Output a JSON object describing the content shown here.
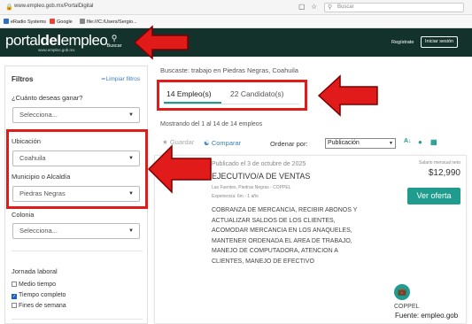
{
  "browser": {
    "url": "www.empleo.gob.mx/PortalDigital",
    "search_placeholder": "Buscar",
    "bookmarks": [
      {
        "label": "eRadio Systems",
        "color": "#2c6fbf"
      },
      {
        "label": "Google",
        "color": "#ea4335"
      },
      {
        "label": "file:///C:/Users/Sergio...",
        "color": "#888888"
      }
    ]
  },
  "header": {
    "logo_light": "portal",
    "logo_bold": "del",
    "logo_end": "empleo",
    "logo_sub": "www.empleo.gob.mx",
    "search_label": "Buscar",
    "register": "Regístrate",
    "login": "Iniciar sesión"
  },
  "sidebar": {
    "title": "Filtros",
    "clear": "Limpiar filtros",
    "salary_label": "¿Cuánto deseas ganar?",
    "salary_value": "Selecciona...",
    "location_label": "Ubicación",
    "location_value": "Coahuila",
    "municipality_label": "Municipio o Alcaldía",
    "municipality_value": "Piedras Negras",
    "colony_label": "Colonia",
    "colony_value": "Selecciona...",
    "schedule_label": "Jornada laboral",
    "schedules": [
      {
        "label": "Medio tiempo",
        "checked": false
      },
      {
        "label": "Tiempo completo",
        "checked": true
      },
      {
        "label": "Fines de semana",
        "checked": false
      }
    ]
  },
  "main": {
    "crumb": "Buscaste: trabajo en Piedras Negras, Coahuila",
    "tab_jobs": "14 Empleo(s)",
    "tab_candidates": "22 Candidato(s)",
    "showing": "Mostrando del 1 al 14 de 14 empleos",
    "save": "Guardar",
    "compare": "Comparar",
    "order_label": "Ordenar por:",
    "order_value": "Publicación"
  },
  "job": {
    "date": "Publicado el 3 de octubre de 2025",
    "title": "EJECUTIVO/A DE VENTAS",
    "company": "Las Fuentes, Piedras Negras - COPPEL",
    "experience": "Experiencia: 6m - 1 año",
    "description": "COBRANZA DE MERCANCIA, RECIBIR ABONOS Y ACTUALIZAR SALDOS DE LOS CLIENTES, ACOMODAR MERCANCIA EN LOS ANAQUELES, MANTENER ORDENADA EL AREA DE TRABAJO, MANEJO DE COMPUTADORA, ATENCION A CLIENTES, MANEJO DE EFECTIVO",
    "salary_label": "Salario mensual neto",
    "salary": "$12,990",
    "button": "Ver oferta",
    "company_name": "COPPEL"
  },
  "source": "Fuente: empleo.gob",
  "colors": {
    "header": "#13322b",
    "accent": "#1f9c8d",
    "highlight": "#e11a1a"
  }
}
